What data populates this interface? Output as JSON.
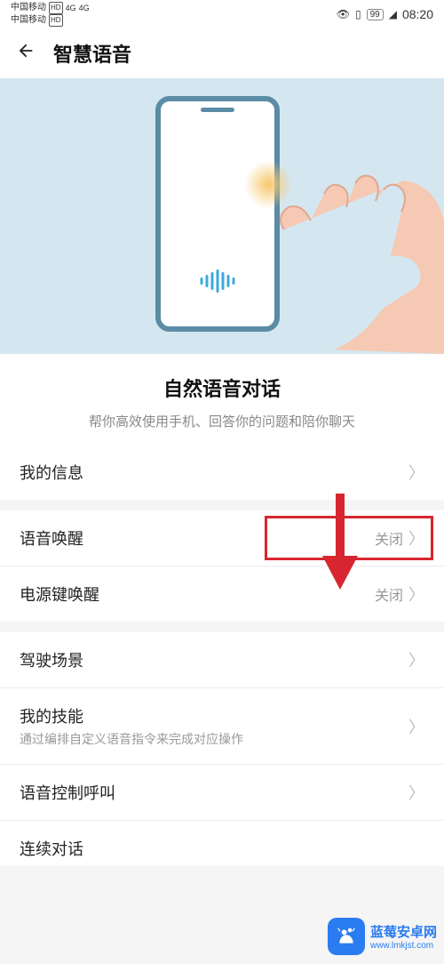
{
  "status": {
    "carrier": "中国移动",
    "hd": "HD",
    "net1": "4G",
    "net2": "4G",
    "battery": "99",
    "time": "08:20"
  },
  "header": {
    "title": "智慧语音"
  },
  "hero": {
    "section_title": "自然语音对话",
    "section_sub": "帮你高效使用手机、回答你的问题和陪你聊天"
  },
  "items": {
    "my_info": {
      "label": "我的信息"
    },
    "voice_wake": {
      "label": "语音唤醒",
      "value": "关闭"
    },
    "power_wake": {
      "label": "电源键唤醒",
      "value": "关闭"
    },
    "driving": {
      "label": "驾驶场景"
    },
    "skills": {
      "label": "我的技能",
      "sub": "通过编排自定义语音指令来完成对应操作"
    },
    "voice_call": {
      "label": "语音控制呼叫"
    },
    "continuous": {
      "label": "连续对话"
    }
  },
  "watermark": {
    "title": "蓝莓安卓网",
    "url": "www.lmkjst.com"
  }
}
